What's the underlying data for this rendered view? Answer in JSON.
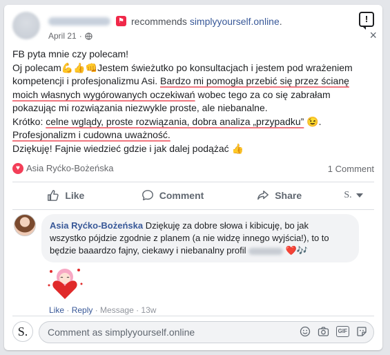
{
  "post": {
    "recommend_text": "recommends",
    "page_link": "simplyyourself.online",
    "period": ".",
    "date": "April 21",
    "date_sep": "·",
    "report_symbol": "!",
    "close_symbol": "×",
    "lines": {
      "l1": "FB pyta mnie czy polecam!",
      "l2": "Oj polecam💪👍👊Jestem świeżutko po konsultacjach i jestem pod wrażeniem",
      "l3a": "kompetencji i profesjonalizmu Asi. ",
      "l3b": "Bardzo mi pomogła przebić się przez ścianę",
      "l4a": "moich własnych wygórowanych oczekiwań",
      "l4b": " wobec tego za co się zabrałam",
      "l5": "pokazując mi rozwiązania niezwykle proste, ale niebanalne.",
      "l6a": "Krótko: ",
      "l6b": "celne wglądy, proste rozwiązania, dobra analiza „przypadku”",
      "l6c": " 😉.",
      "l7": "Profesjonalizm i cudowna uważność.",
      "l8": "Dziękuję! Fajnie wiedzieć gdzie i jak dalej podążać 👍"
    }
  },
  "reactions": {
    "icon": "♥",
    "name": "Asia Ryćko-Bożeńska",
    "comment_count": "1 Comment"
  },
  "actions": {
    "like": "Like",
    "comment": "Comment",
    "share": "Share",
    "page_initial": "S."
  },
  "comment": {
    "author": "Asia Ryćko-Bożeńska",
    "text1": " Dziękuję za dobre słowa i kibicuję, bo jak",
    "text2": "wszystko pójdzie zgodnie z planem (a nie widzę innego wyjścia!), to to",
    "text3": "będzie baaardzo fajny, ciekawy i niebanalny profil",
    "text3_end": " ❤️🎶",
    "like": "Like",
    "reply": "Reply",
    "message": "Message",
    "time": "13w",
    "sep": " · "
  },
  "composer": {
    "logo": "S.",
    "placeholder": "Comment as simplyyourself.online"
  },
  "colors": {
    "link": "#385898",
    "underline": "#f0767f",
    "heart": "#f33e58",
    "recommend": "#f02849"
  }
}
